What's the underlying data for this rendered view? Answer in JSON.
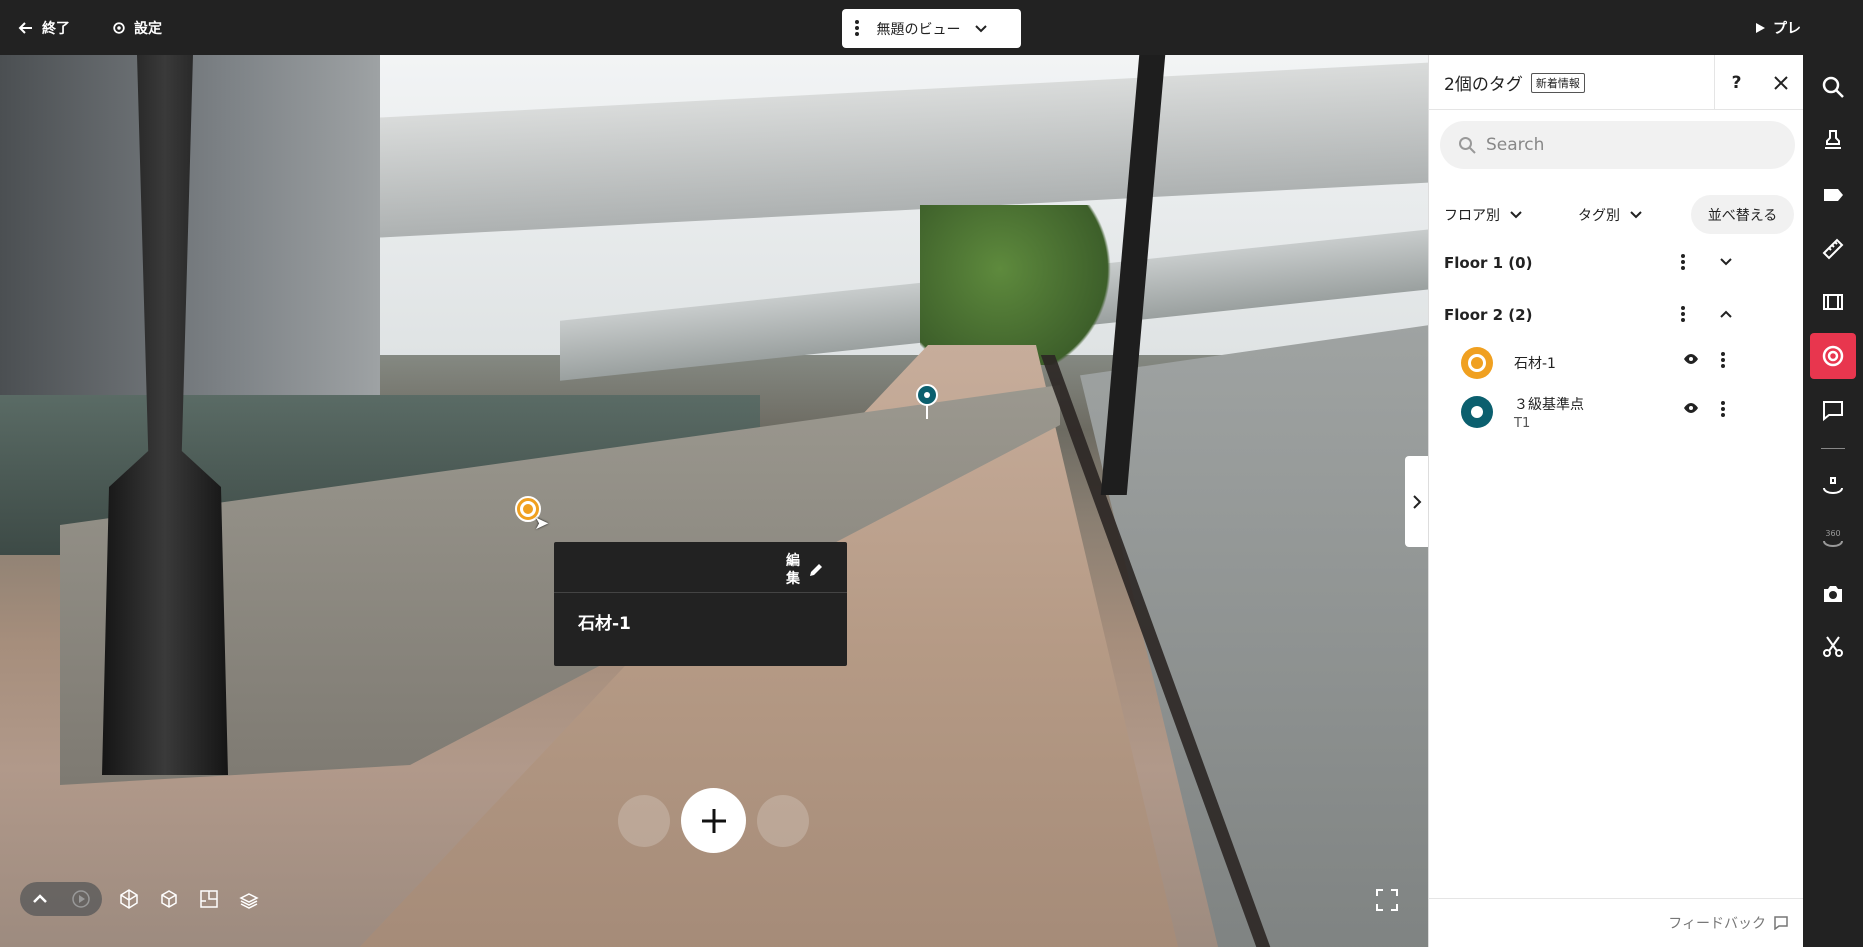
{
  "topbar": {
    "exit_label": "終了",
    "settings_label": "設定",
    "view_name": "無題のビュー",
    "preview_label": "プレビュー"
  },
  "viewer": {
    "popup": {
      "edit_label_line1": "編",
      "edit_label_line2": "集",
      "title": "石材-1"
    }
  },
  "panel": {
    "title": "2個のタグ",
    "badge": "新着情報",
    "help_label": "?",
    "search_placeholder": "Search",
    "filter_floor": "フロア別",
    "filter_tag": "タグ別",
    "sort_label": "並べ替える",
    "floors": [
      {
        "label": "Floor 1 (0)",
        "expanded": false
      },
      {
        "label": "Floor 2 (2)",
        "expanded": true
      }
    ],
    "tags": [
      {
        "name": "石材-1",
        "sub": "",
        "color": "#f0a020"
      },
      {
        "name": "３級基準点",
        "sub": "T1",
        "color": "#0b5f6e"
      }
    ],
    "feedback_label": "フィードバック"
  },
  "toolbar": {
    "icons": [
      "search-icon",
      "stamp-icon",
      "tag-icon",
      "ruler-icon",
      "film-icon",
      "target-icon",
      "comment-icon",
      "rotate-icon",
      "360-icon",
      "camera-icon",
      "scissors-icon"
    ],
    "active": "target-icon",
    "label_360": "360"
  },
  "colors": {
    "accent": "#e8364e",
    "tag_orange": "#f0a020",
    "tag_teal": "#0b5f6e",
    "bar_bg": "#222222"
  }
}
